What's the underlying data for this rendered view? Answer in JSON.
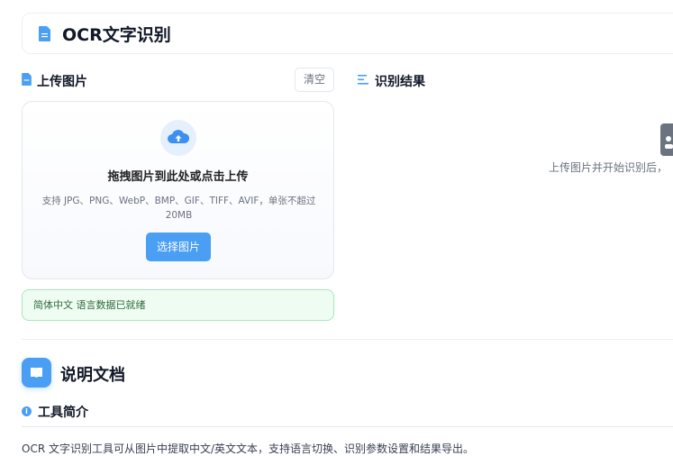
{
  "header": {
    "title": "OCR文字识别"
  },
  "upload": {
    "title": "上传图片",
    "clear_label": "清空",
    "drop_title": "拖拽图片到此处或点击上传",
    "drop_hint": "支持 JPG、PNG、WebP、BMP、GIF、TIFF、AVIF，单张不超过20MB",
    "pick_label": "选择图片",
    "status": "简体中文 语言数据已就绪"
  },
  "result": {
    "title": "识别结果",
    "placeholder": "上传图片并开始识别后，"
  },
  "docs": {
    "title": "说明文档",
    "intro_title": "工具简介",
    "intro_text": "OCR 文字识别工具可从图片中提取中文/英文文本，支持语言切换、识别参数设置和结果导出。"
  },
  "colors": {
    "accent": "#4a9ff5",
    "success_bg": "#effcf2"
  }
}
